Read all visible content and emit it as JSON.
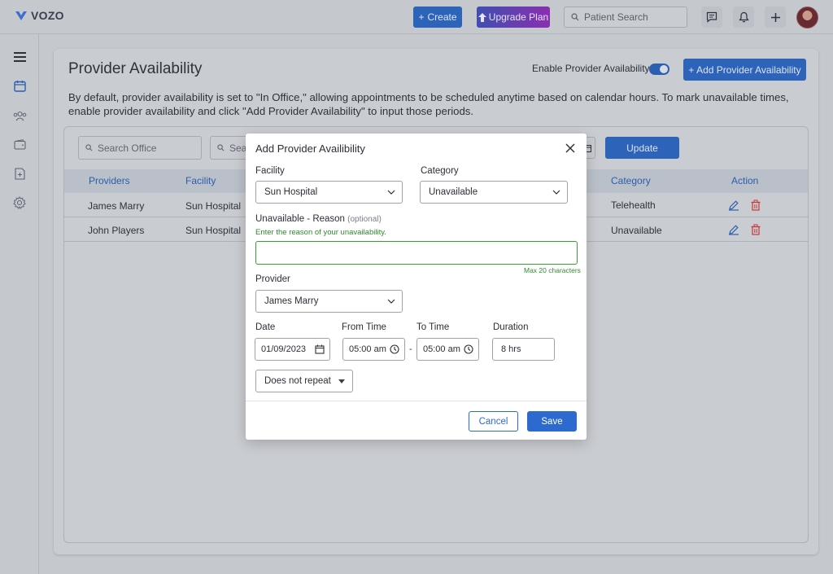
{
  "app": {
    "logo_text": "VOZO",
    "brand_color": "#2d63b8"
  },
  "topbar": {
    "create_label": "Create",
    "upgrade_label": "Upgrade Plan",
    "search_placeholder": "Patient Search",
    "icons": [
      "chat-icon",
      "bell-icon",
      "plus-icon",
      "user-avatar"
    ]
  },
  "sidebar": {
    "items": [
      "menu-icon",
      "calendar-icon",
      "users-icon",
      "wallet-icon",
      "document-plus-icon",
      "gear-icon"
    ]
  },
  "page": {
    "title": "Provider Availability",
    "enable_label": "Enable Provider Availability",
    "enable_on": true,
    "add_button": "+ Add Provider Availability",
    "description": "By default, provider availability is set to \"In Office,\" allowing appointments to be scheduled anytime based on calendar hours. To mark unavailable times, enable provider availability and click \"Add Provider Availability\" to input those periods."
  },
  "filters": {
    "search_office_placeholder": "Search Office",
    "search_2_placeholder": "Sear",
    "update_button": "Update"
  },
  "table": {
    "headers": {
      "providers": "Providers",
      "facility": "Facility",
      "category": "Category",
      "action": "Action"
    },
    "rows": [
      {
        "provider": "James Marry",
        "facility": "Sun Hospital",
        "category": "Telehealth"
      },
      {
        "provider": "John Players",
        "facility": "Sun Hospital",
        "category": "Unavailable"
      }
    ]
  },
  "modal": {
    "title": "Add Provider Availibility",
    "facility_label": "Facility",
    "facility_value": "Sun Hospital",
    "category_label": "Category",
    "category_value": "Unavailable",
    "reason_label": "Unavailable - Reason",
    "reason_optional": "(optional)",
    "reason_hint": "Enter the reason of your unavailability.",
    "reason_value": "",
    "reason_max": "Max 20 characters",
    "provider_label": "Provider",
    "provider_value": "James Marry",
    "date_label": "Date",
    "date_value": "01/09/2023",
    "from_label": "From Time",
    "from_value": "05:00 am",
    "dash": "-",
    "to_label": "To Time",
    "to_value": "05:00 am",
    "duration_label": "Duration",
    "duration_value": "8 hrs",
    "repeat_value": "Does not repeat",
    "cancel_label": "Cancel",
    "save_label": "Save"
  }
}
